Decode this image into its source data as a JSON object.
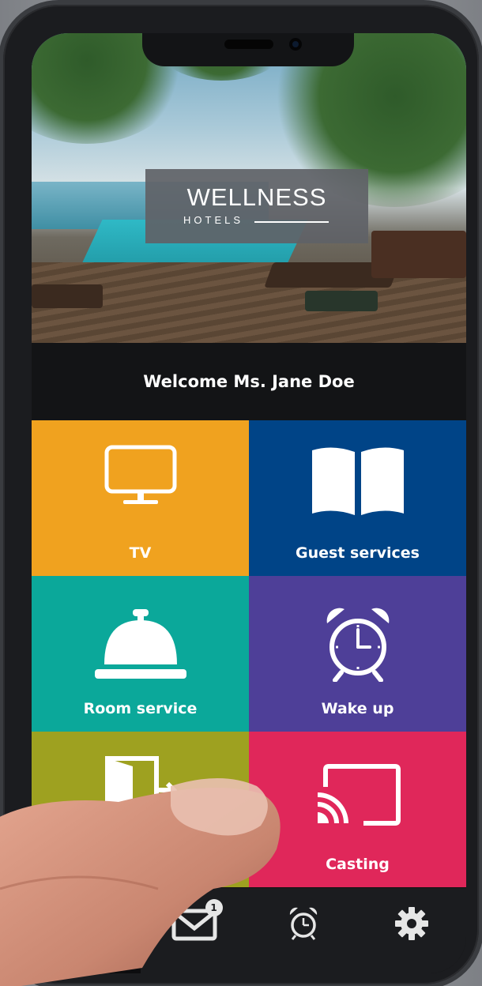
{
  "hotel": {
    "name": "WELLNESS",
    "subtitle": "HOTELS"
  },
  "welcome": {
    "text": "Welcome Ms. Jane Doe"
  },
  "tiles": [
    {
      "label": "TV",
      "icon": "tv-icon",
      "color": "#f0a21f"
    },
    {
      "label": "Guest services",
      "icon": "book-icon",
      "color": "#004487"
    },
    {
      "label": "Room service",
      "icon": "service-bell-icon",
      "color": "#0ba89a"
    },
    {
      "label": "Wake up",
      "icon": "alarm-clock-icon",
      "color": "#4e3f98"
    },
    {
      "label": "",
      "icon": "checkout-door-icon",
      "color": "#9ea120"
    },
    {
      "label": "Casting",
      "icon": "cast-icon",
      "color": "#e0275a"
    }
  ],
  "tabbar": {
    "items": [
      {
        "icon": "menu-icon"
      },
      {
        "icon": "mail-icon",
        "badge": "1"
      },
      {
        "icon": "alarm-clock-icon"
      },
      {
        "icon": "gear-icon"
      }
    ]
  }
}
